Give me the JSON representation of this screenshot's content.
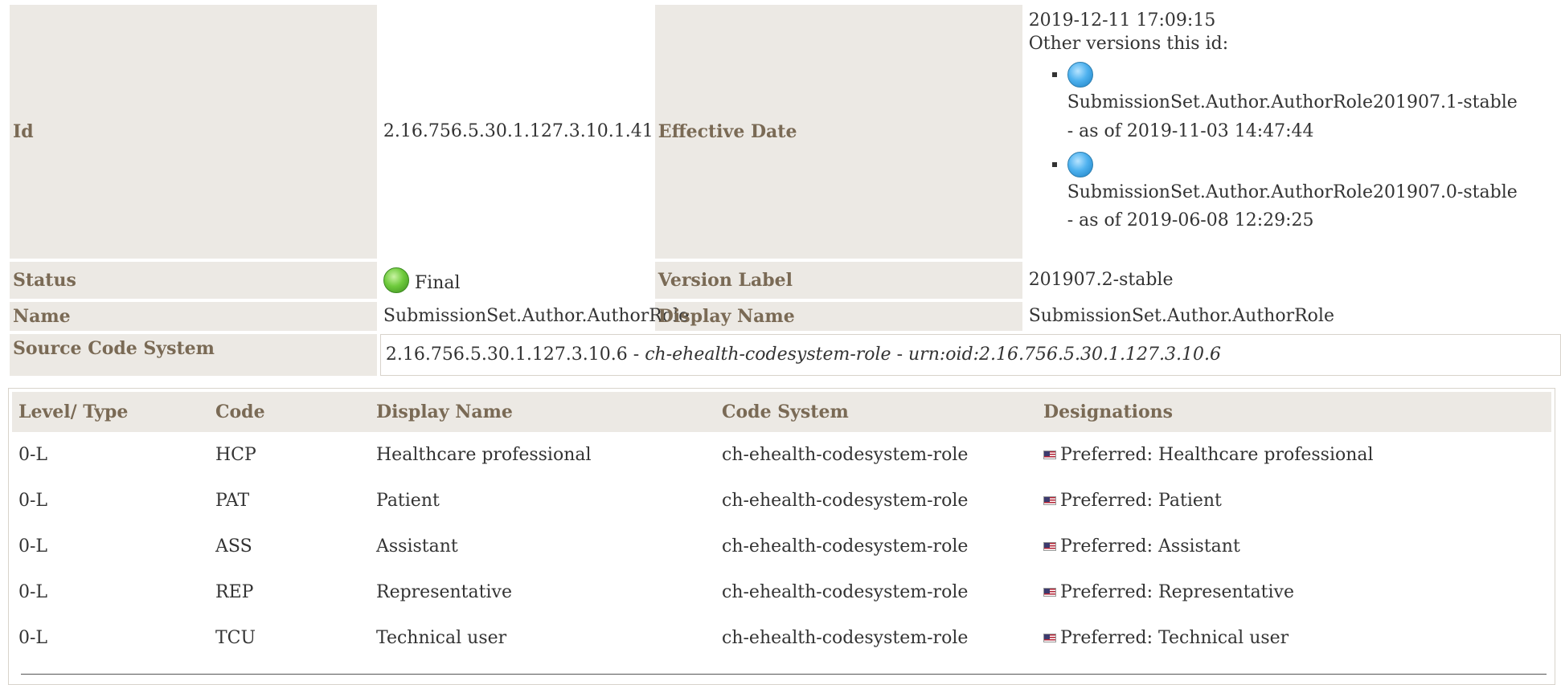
{
  "meta": {
    "id_label": "Id",
    "id_value": "2.16.756.5.30.1.127.3.10.1.41",
    "effective_date_label": "Effective Date",
    "effective_date_value": "2019-12-11 17:09:15",
    "other_versions_label": "Other versions this id:",
    "other_versions": [
      {
        "name": "SubmissionSet.Author.AuthorRole201907.1-stable",
        "as_of": "- as of 2019-11-03 14:47:44",
        "icon": "blue-ball-icon"
      },
      {
        "name": "SubmissionSet.Author.AuthorRole201907.0-stable",
        "as_of": "- as of 2019-06-08 12:29:25",
        "icon": "blue-ball-icon"
      }
    ],
    "status_label": "Status",
    "status_value": "Final",
    "status_icon": "green-ball-icon",
    "version_label_label": "Version Label",
    "version_label_value": "201907.2-stable",
    "name_label": "Name",
    "name_value": "SubmissionSet.Author.AuthorRole",
    "display_name_label": "Display Name",
    "display_name_value": "SubmissionSet.Author.AuthorRole",
    "source_code_system_label": "Source Code System",
    "source_code_system_oid": "2.16.756.5.30.1.127.3.10.6",
    "source_code_system_sep1": " - ",
    "source_code_system_name": "ch-ehealth-codesystem-role",
    "source_code_system_sep2": " - ",
    "source_code_system_urn": "urn:oid:2.16.756.5.30.1.127.3.10.6"
  },
  "codes": {
    "headers": [
      "Level/ Type",
      "Code",
      "Display Name",
      "Code System",
      "Designations"
    ],
    "rows": [
      {
        "level": "0-L",
        "code": "HCP",
        "display": "Healthcare professional",
        "system": "ch-ehealth-codesystem-role",
        "designation": "Preferred: Healthcare professional"
      },
      {
        "level": "0-L",
        "code": "PAT",
        "display": "Patient",
        "system": "ch-ehealth-codesystem-role",
        "designation": "Preferred: Patient"
      },
      {
        "level": "0-L",
        "code": "ASS",
        "display": "Assistant",
        "system": "ch-ehealth-codesystem-role",
        "designation": "Preferred: Assistant"
      },
      {
        "level": "0-L",
        "code": "REP",
        "display": "Representative",
        "system": "ch-ehealth-codesystem-role",
        "designation": "Preferred: Representative"
      },
      {
        "level": "0-L",
        "code": "TCU",
        "display": "Technical user",
        "system": "ch-ehealth-codesystem-role",
        "designation": "Preferred: Technical user"
      }
    ],
    "designation_icon": "us-flag-icon"
  },
  "colors": {
    "label_bg": "#ece9e4",
    "label_text": "#7a6a55",
    "status_final": "#6fcb3d",
    "version_ball": "#4fb2ef"
  }
}
